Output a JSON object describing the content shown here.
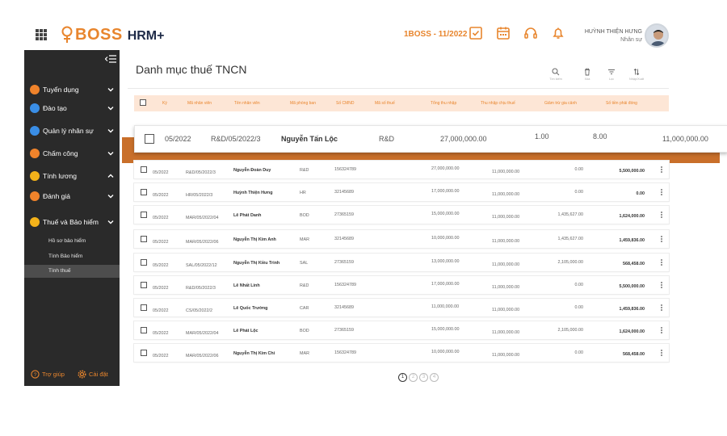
{
  "header": {
    "logo_text": "BOSS",
    "logo_sub": "HRM+",
    "period": "1BOSS - 11/2022",
    "user_name": "HUỲNH THIỆN HƯNG",
    "user_role": "Nhân sự",
    "icons": [
      "apps-grid-icon",
      "checklist-icon",
      "calendar-icon",
      "headset-icon",
      "bell-icon"
    ]
  },
  "sidebar": {
    "items": [
      {
        "label": "Tuyển dụng",
        "color": "#f0832b",
        "icon": "recruit-icon",
        "chevron": "down"
      },
      {
        "label": "Đào tạo",
        "color": "#3a8ee6",
        "icon": "training-icon",
        "chevron": "down"
      },
      {
        "label": "Quản lý nhân sự",
        "color": "#3a8ee6",
        "icon": "people-icon",
        "chevron": "down"
      },
      {
        "label": "Chấm công",
        "color": "#f0832b",
        "icon": "timesheet-icon",
        "chevron": "down"
      },
      {
        "label": "Tính lương",
        "color": "#f3b21a",
        "icon": "salary-icon",
        "chevron": "up"
      },
      {
        "label": "Đánh giá",
        "color": "#f0832b",
        "icon": "review-icon",
        "chevron": "down"
      },
      {
        "label": "Thuế và Bảo hiểm",
        "color": "#f3b21a",
        "icon": "tax-icon",
        "chevron": "down"
      }
    ],
    "subitems": [
      {
        "label": "Hồ sơ bảo hiểm",
        "active": false
      },
      {
        "label": "Tính Bảo hiểm",
        "active": false
      },
      {
        "label": "Tính thuế",
        "active": true
      }
    ],
    "help_label": "Trợ giúp",
    "settings_label": "Cài đặt"
  },
  "main": {
    "title": "Danh mục thuế TNCN",
    "toolbar": [
      {
        "label": "Tìm kiếm",
        "icon": "search-icon"
      },
      {
        "label": "Xóa",
        "icon": "trash-icon"
      },
      {
        "label": "Lọc",
        "icon": "filter-icon"
      },
      {
        "label": "Nhập/Xuất",
        "icon": "sort-icon"
      }
    ],
    "columns": [
      "Kỳ",
      "Mã nhân viên",
      "Tên nhân viên",
      "Mã phòng ban",
      "Số CMND",
      "Mã số thuế",
      "Tổng thu nhập",
      "Thu nhập chịu thuế",
      "Giảm trừ gia cảnh",
      "Số tiền phải đóng"
    ],
    "dragged_row": {
      "period": "05/2022",
      "emp_id": "R&D/05/2022/3",
      "name": "Nguyễn Tấn Lộc",
      "dept": "R&D",
      "total": "27,000,000.00",
      "a": "1.00",
      "b": "8.00",
      "paid": "11,000,000.00"
    },
    "rows": [
      {
        "period": "05/2022",
        "emp_id": "R&D/05/2022/3",
        "name": "Nguyễn Đoàn Duy",
        "dept": "R&D",
        "cmnd": "156324789",
        "total": "27,000,000.00",
        "taxable": "11,000,000.00",
        "deduction": "0.00",
        "paid": "5,500,000.00"
      },
      {
        "period": "05/2022",
        "emp_id": "HR/05/2022/3",
        "name": "Huỳnh Thiện Hưng",
        "dept": "HR",
        "cmnd": "32145689",
        "total": "17,000,000.00",
        "taxable": "11,000,000.00",
        "deduction": "0.00",
        "paid": "0.00"
      },
      {
        "period": "05/2022",
        "emp_id": "MAR/05/2022/04",
        "name": "Lê Phát Danh",
        "dept": "BOD",
        "cmnd": "27365159",
        "total": "15,000,000.00",
        "taxable": "11,000,000.00",
        "deduction": "1,435,627.00",
        "paid": "1,624,000.00"
      },
      {
        "period": "05/2022",
        "emp_id": "MAR/05/2022/06",
        "name": "Nguyễn Thị Kim Anh",
        "dept": "MAR",
        "cmnd": "32145689",
        "total": "10,000,000.00",
        "taxable": "11,000,000.00",
        "deduction": "1,435,627.00",
        "paid": "1,459,836.00"
      },
      {
        "period": "05/2022",
        "emp_id": "SAL/05/2022/12",
        "name": "Nguyễn Thị Kiều Trinh",
        "dept": "SAL",
        "cmnd": "27365159",
        "total": "13,000,000.00",
        "taxable": "11,000,000.00",
        "deduction": "2,105,000.00",
        "paid": "568,458.00"
      },
      {
        "period": "05/2022",
        "emp_id": "R&D/05/2022/3",
        "name": "Lê Nhất Linh",
        "dept": "R&D",
        "cmnd": "156324789",
        "total": "17,000,000.00",
        "taxable": "11,000,000.00",
        "deduction": "0.00",
        "paid": "5,500,000.00"
      },
      {
        "period": "05/2022",
        "emp_id": "CS/05/2022/2",
        "name": "Lê Quốc Trường",
        "dept": "CAR",
        "cmnd": "32145689",
        "total": "11,000,000.00",
        "taxable": "11,000,000.00",
        "deduction": "0.00",
        "paid": "1,459,836.00"
      },
      {
        "period": "05/2022",
        "emp_id": "MAR/05/2022/04",
        "name": "Lê Phát Lộc",
        "dept": "BOD",
        "cmnd": "27365159",
        "total": "15,000,000.00",
        "taxable": "11,000,000.00",
        "deduction": "2,105,000.00",
        "paid": "1,624,000.00"
      },
      {
        "period": "05/2022",
        "emp_id": "MAR/05/2022/06",
        "name": "Nguyễn Thị Kim Chi",
        "dept": "MAR",
        "cmnd": "156324789",
        "total": "10,000,000.00",
        "taxable": "11,000,000.00",
        "deduction": "0.00",
        "paid": "568,458.00"
      }
    ],
    "pages": [
      "1",
      "2",
      "3",
      "4"
    ],
    "current_page": "1"
  },
  "colors": {
    "accent": "#e8852d",
    "sidebar_bg": "#2a2a2a",
    "header_row": "#fde6d6",
    "drag_shadow": "#c96f2a"
  }
}
